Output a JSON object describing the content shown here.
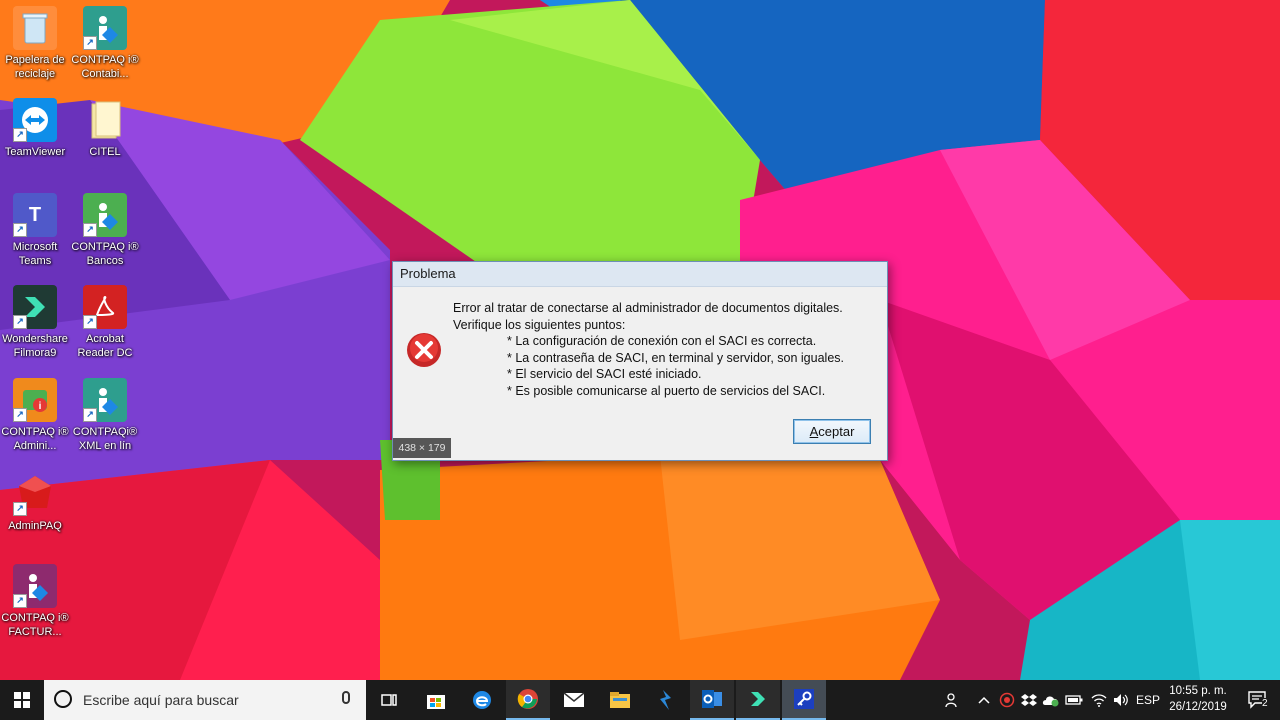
{
  "desktop_icons": [
    {
      "label": "Papelera de reciclaje",
      "icon": "recycle-bin-icon"
    },
    {
      "label": "CONTPAQ i® Contabi...",
      "icon": "contpaq-icon"
    },
    {
      "label": "TeamViewer",
      "icon": "teamviewer-icon"
    },
    {
      "label": "CITEL",
      "icon": "folder-icon"
    },
    {
      "label": "Microsoft Teams",
      "icon": "teams-icon"
    },
    {
      "label": "CONTPAQ i® Bancos",
      "icon": "contpaq-icon"
    },
    {
      "label": "Wondershare Filmora9",
      "icon": "filmora-icon"
    },
    {
      "label": "Acrobat Reader DC",
      "icon": "acrobat-icon"
    },
    {
      "label": "CONTPAQ i® Admini...",
      "icon": "contpaq-admin-icon"
    },
    {
      "label": "CONTPAQi® XML en lín",
      "icon": "contpaq-icon"
    },
    {
      "label": "AdminPAQ",
      "icon": "adminpaq-icon"
    },
    {
      "label": "CONTPAQ i® FACTUR...",
      "icon": "contpaq-factura-icon"
    }
  ],
  "dialog": {
    "title": "Problema",
    "line1": "Error al tratar de conectarse al administrador de documentos digitales.",
    "line2": "Verifique los siguientes puntos:",
    "bullets": [
      "* La configuración de conexión con el SACI es correcta.",
      "* La contraseña de SACI, en terminal y servidor, son iguales.",
      "* El servicio del SACI esté iniciado.",
      "* Es posible comunicarse al puerto de servicios del SACI."
    ],
    "accept_label": "ceptar",
    "accept_mnemonic": "A",
    "size_overlay": "438 × 179",
    "colors": {
      "error_red": "#d32f2f",
      "button_border": "#3c7fb1"
    }
  },
  "taskbar": {
    "search_placeholder": "Escribe aquí para buscar",
    "apps": [
      "task-view-icon",
      "store-icon",
      "edge-icon",
      "chrome-icon",
      "mail-icon",
      "file-explorer-icon",
      "power-automate-icon",
      "outlook-icon",
      "filmora-icon",
      "key-app-icon"
    ],
    "language": "ESP",
    "time": "10:55 p. m.",
    "date": "26/12/2019",
    "notification_count": "2"
  }
}
